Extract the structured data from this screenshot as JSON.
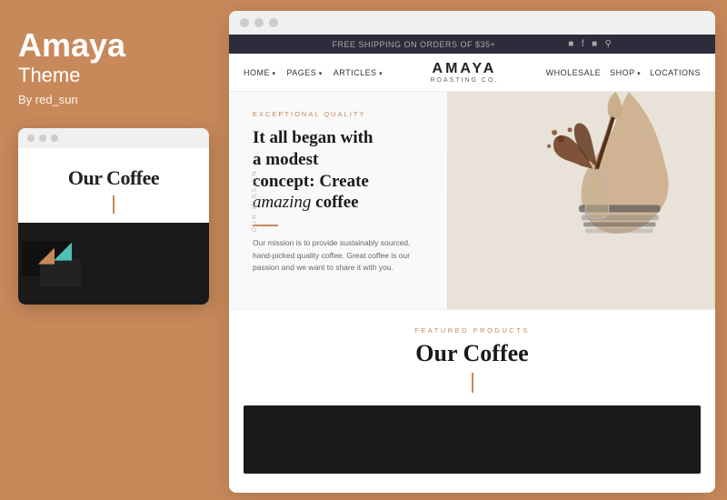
{
  "left_panel": {
    "title": "Amaya",
    "subtitle": "Theme",
    "author": "By red_sun",
    "mini_preview": {
      "our_coffee": "Our Coffee"
    }
  },
  "browser": {
    "dots": [
      "dot1",
      "dot2",
      "dot3"
    ],
    "notif_bar": {
      "message": "FREE SHIPPING ON ORDERS OF $35+",
      "icons": [
        "instagram",
        "facebook",
        "camera",
        "search"
      ]
    },
    "nav": {
      "left_items": [
        "HOME",
        "PAGES",
        "ARTICLES"
      ],
      "logo_main": "AMAYA",
      "logo_sub": "ROASTING CO.",
      "right_items": [
        "WHOLESALE",
        "SHOP",
        "LOCATIONS"
      ]
    },
    "hero": {
      "mission_label": "OUR MISSION",
      "tag": "EXCEPTIONAL QUALITY",
      "title_line1": "It all began with",
      "title_line2": "a modest",
      "title_line3": "concept: Create",
      "title_italic": "amazing",
      "title_end": " coffee",
      "description": "Our mission is to provide sustainably sourced, hand-picked quality coffee. Great coffee is our passion and we want to share it with you."
    },
    "featured": {
      "tag": "FEATURED PRODUCTS",
      "title": "Our Coffee"
    }
  }
}
